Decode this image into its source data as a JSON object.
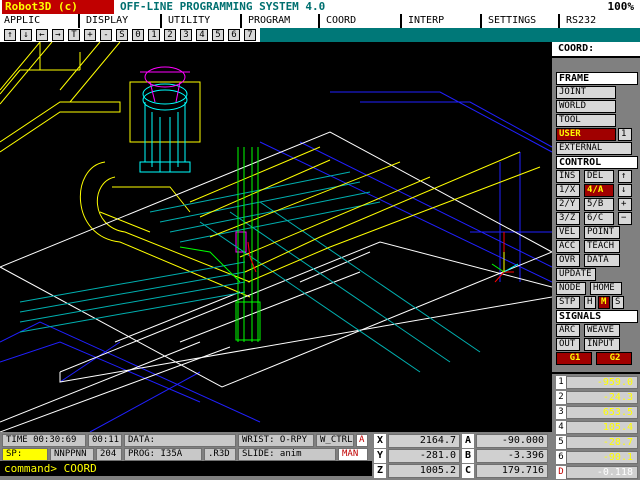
{
  "title": {
    "app": "Robot3D (c)",
    "system": "OFF-LINE PROGRAMMING SYSTEM 4.0",
    "zoom": "100%"
  },
  "menu": [
    "APPLIC",
    "DISPLAY",
    "UTILITY",
    "PROGRAM",
    "COORD",
    "INTERP",
    "SETTINGS",
    "RS232"
  ],
  "toolbar": [
    "↑",
    "↓",
    "←",
    "→",
    "T",
    "+",
    "-",
    "S",
    "0",
    "1",
    "2",
    "3",
    "4",
    "5",
    "6",
    "7"
  ],
  "coord_label": "COORD:",
  "panel": {
    "frame_head": "FRAME",
    "joint": "JOINT",
    "world": "WORLD",
    "tool": "TOOL",
    "user": "USER",
    "user_num": "1",
    "external": "EXTERNAL",
    "control_head": "CONTROL",
    "ins": "INS",
    "del": "DEL",
    "up": "↑",
    "x1": "1/X",
    "a4": "4/A",
    "down": "↓",
    "y2": "2/Y",
    "b5": "5/B",
    "plus": "+",
    "z3": "3/Z",
    "c6": "6/C",
    "minus": "−",
    "vel": "VEL",
    "point": "POINT",
    "acc": "ACC",
    "teach": "TEACH",
    "ovr": "OVR",
    "data": "DATA",
    "update": "UPDATE",
    "node": "NODE",
    "home": "HOME",
    "stp": "STP",
    "h": "H",
    "m": "M",
    "s": "S",
    "signals_head": "SIGNALS",
    "arc": "ARC",
    "weave": "WEAVE",
    "out": "OUT",
    "input": "INPUT",
    "g1": "G1",
    "g2": "G2"
  },
  "joints": [
    {
      "label": "1",
      "value": "-959.0"
    },
    {
      "label": "2",
      "value": "-24.3"
    },
    {
      "label": "3",
      "value": "653.5"
    },
    {
      "label": "4",
      "value": "105.4"
    },
    {
      "label": "5",
      "value": "-28.7"
    },
    {
      "label": "6",
      "value": "-90.1"
    },
    {
      "label": "D",
      "value": "-0.118"
    }
  ],
  "status": {
    "time": "TIME 00:30:69",
    "time2": "00:11",
    "data": "DATA:",
    "wrist": "WRIST: O-RPY",
    "wctrl": "W_CTRL",
    "a": "A",
    "sp": "SP:",
    "nnppnn": "NNPPNN",
    "n204": "204",
    "prog": "PROG: I35A",
    "r3d": ".R3D",
    "slide": "SLIDE: anim",
    "man": "MAN"
  },
  "coords": {
    "x_label": "X",
    "x": "2164.7",
    "a_label": "A",
    "a": "-90.000",
    "y_label": "Y",
    "y": "-281.0",
    "b_label": "B",
    "b": "-3.396",
    "z_label": "Z",
    "z": "1005.2",
    "c_label": "C",
    "c": "179.716"
  },
  "command": "command> COORD",
  "colors": {
    "teal": "#007878",
    "red": "#a00000",
    "yellow": "#ffff00"
  }
}
